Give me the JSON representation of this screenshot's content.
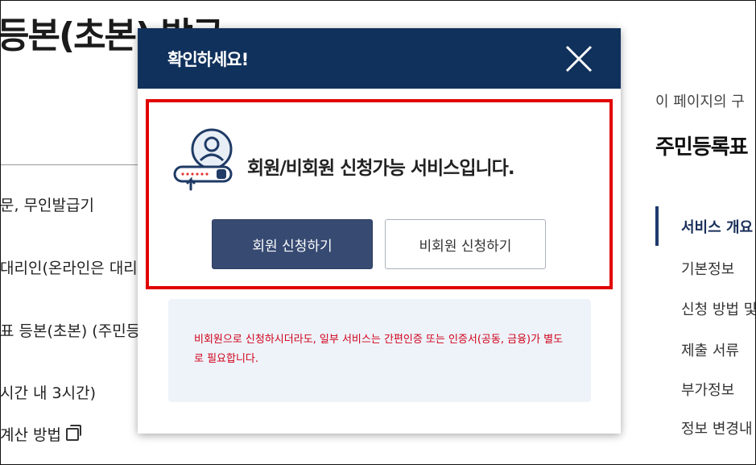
{
  "background": {
    "page_title": "등본(초본) 발급",
    "lines": [
      "문, 무인발급기",
      "대리인(온라인은 대리",
      "표 등본(초본) (주민등",
      "시간 내 3시간)",
      "계산 방법"
    ],
    "right_desc": "이 페이지의 구",
    "right_heading": "주민등록표",
    "side_nav": [
      "서비스 개요",
      "기본정보",
      "신청 방법 및",
      "제출 서류",
      "부가정보",
      "정보 변경내"
    ]
  },
  "modal": {
    "title": "확인하세요!",
    "close_icon": "close-icon",
    "notice_icon": "user-login-icon",
    "notice": "회원/비회원 신청가능 서비스입니다.",
    "member_button": "회원 신청하기",
    "guest_button": "비회원 신청하기",
    "info": "비회원으로 신청하시더라도, 일부 서비스는 간편인증 또는 인증서(공동, 금융)가 별도로 필요합니다."
  },
  "colors": {
    "header_bg": "#10315c",
    "highlight_border": "#e10000",
    "member_button_bg": "#374a72",
    "info_text": "#d0021b",
    "info_bg": "#eef3f9"
  }
}
